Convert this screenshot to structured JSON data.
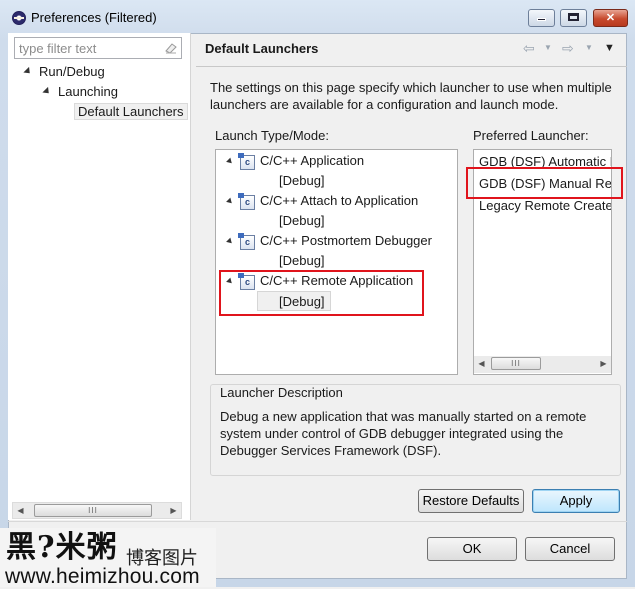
{
  "window": {
    "title": "Preferences (Filtered)",
    "minimize_glyph": "",
    "maximize_glyph": "",
    "close_glyph": "✕"
  },
  "sidebar": {
    "filter_placeholder": "type filter text",
    "filter_value": "",
    "tree": [
      {
        "label": "Run/Debug",
        "level": 0,
        "expanded": true
      },
      {
        "label": "Launching",
        "level": 1,
        "expanded": true
      },
      {
        "label": "Default Launchers",
        "level": 2,
        "selected": true
      }
    ],
    "scroll_thumb_glyph": "III"
  },
  "page": {
    "title": "Default Launchers",
    "nav": {
      "back": "⇦",
      "forward": "⇨",
      "menu": "▼"
    },
    "description": "The settings on this page specify which launcher to use when multiple launchers are available for a configuration and launch mode.",
    "launch_type_label": "Launch Type/Mode:",
    "preferred_label": "Preferred Launcher:",
    "launch_types": [
      {
        "label": "C/C++ Application",
        "mode": "[Debug]"
      },
      {
        "label": "C/C++ Attach to Application",
        "mode": "[Debug]"
      },
      {
        "label": "C/C++ Postmortem Debugger",
        "mode": "[Debug]"
      },
      {
        "label": "C/C++ Remote Application",
        "mode": "[Debug]",
        "highlighted": true
      }
    ],
    "type_icon_letter": "c",
    "launchers": [
      {
        "label": "GDB (DSF) Automatic R"
      },
      {
        "label": "GDB (DSF) Manual Ren",
        "highlighted": true
      },
      {
        "label": "Legacy Remote Create"
      }
    ],
    "launcher_scroll_thumb_glyph": "III",
    "launcher_description_title": "Launcher Description",
    "launcher_description": "Debug a new application that was manually started on a remote system under control of GDB debugger integrated using the Debugger Services Framework (DSF).",
    "restore_defaults_label": "Restore Defaults",
    "apply_label": "Apply"
  },
  "footer": {
    "ok_label": "OK",
    "cancel_label": "Cancel"
  },
  "watermark": {
    "logo": "黑?米粥",
    "tagline": "博客图片",
    "url": "www.heimizhou.com"
  },
  "colors": {
    "highlight_box": "#e0141c",
    "title_bar": "#dbe7f4",
    "default_button": "#bee6fd"
  }
}
